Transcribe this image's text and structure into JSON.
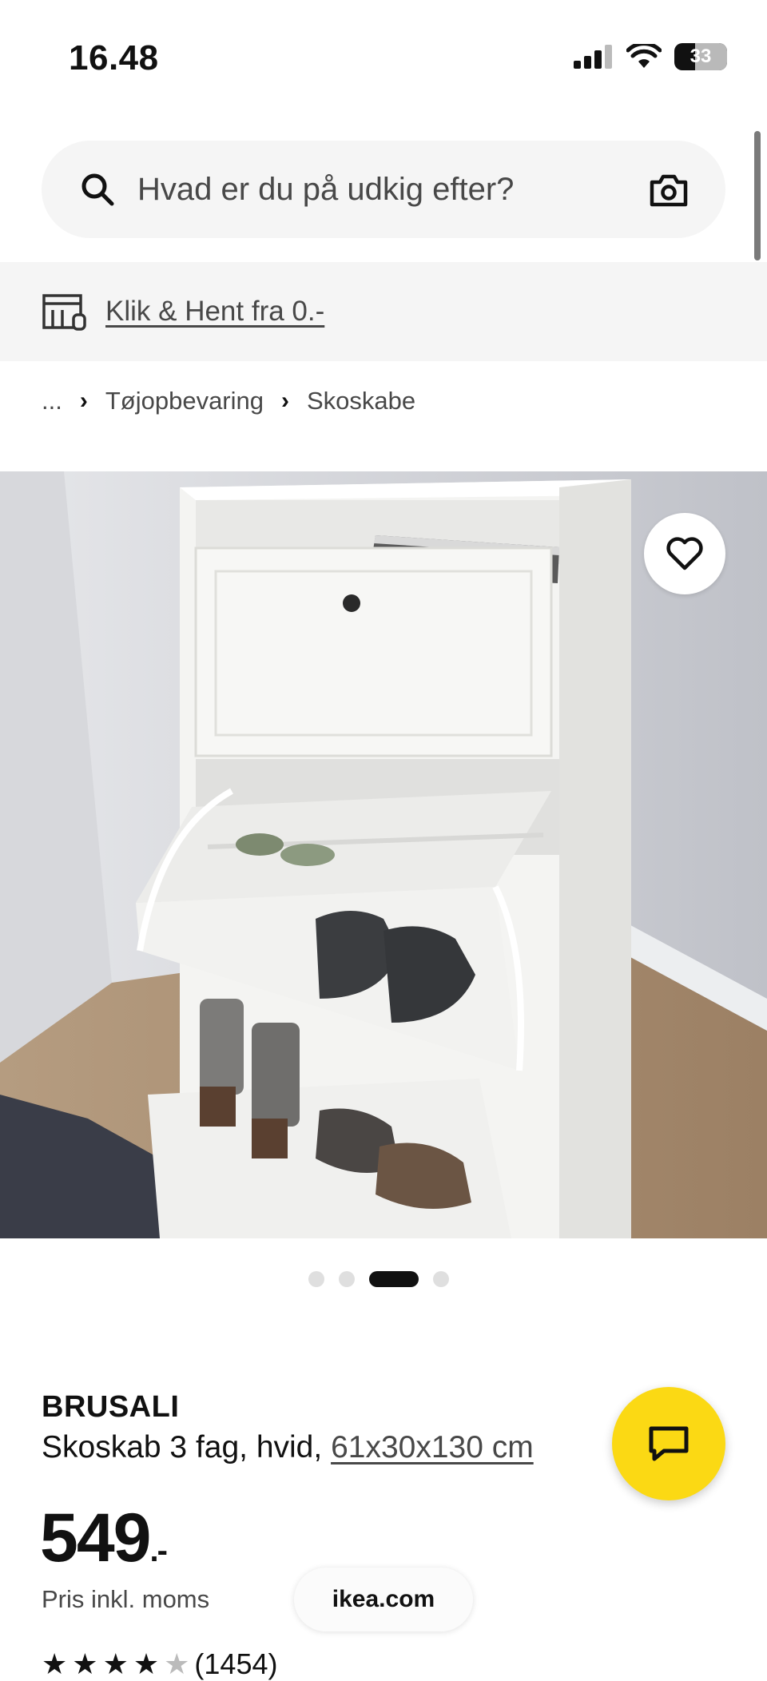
{
  "status_bar": {
    "time": "16.48",
    "battery_level": "33"
  },
  "search": {
    "placeholder": "Hvad er du på udkig efter?",
    "search_icon": "search-icon",
    "camera_icon": "camera-icon"
  },
  "banner": {
    "icon": "store-icon",
    "link_label": "Klik & Hent fra 0.-"
  },
  "breadcrumb": {
    "items": [
      "...",
      "Tøjopbevaring",
      "Skoskabe"
    ],
    "separator": "›"
  },
  "carousel": {
    "total_images": 4,
    "active_index": 3
  },
  "product": {
    "brand": "BRUSALI",
    "description": "Skoskab 3 fag, hvid,",
    "dimensions": "61x30x130 cm",
    "price": "549",
    "price_suffix": ".-",
    "price_note": "Pris inkl. moms",
    "rating_count": "(1454)",
    "rating_stars": 4.5
  },
  "browser": {
    "url": "ikea.com"
  },
  "colors": {
    "chat_button": "#fbd914",
    "surface": "#f5f5f5",
    "text": "#111111",
    "muted_text": "#484848"
  }
}
